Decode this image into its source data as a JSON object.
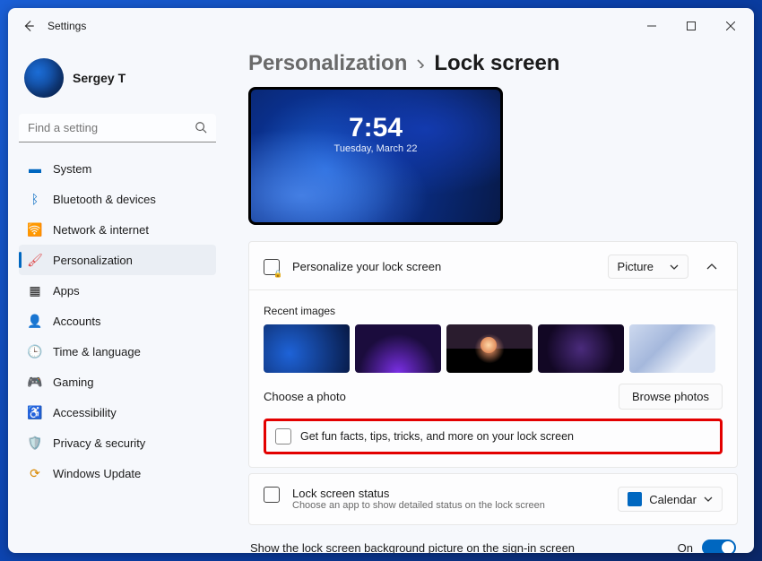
{
  "app_title": "Settings",
  "user": {
    "name": "Sergey T"
  },
  "search": {
    "placeholder": "Find a setting"
  },
  "nav": {
    "items": [
      {
        "label": "System"
      },
      {
        "label": "Bluetooth & devices"
      },
      {
        "label": "Network & internet"
      },
      {
        "label": "Personalization"
      },
      {
        "label": "Apps"
      },
      {
        "label": "Accounts"
      },
      {
        "label": "Time & language"
      },
      {
        "label": "Gaming"
      },
      {
        "label": "Accessibility"
      },
      {
        "label": "Privacy & security"
      },
      {
        "label": "Windows Update"
      }
    ]
  },
  "breadcrumb": {
    "parent": "Personalization",
    "current": "Lock screen"
  },
  "preview": {
    "time": "7:54",
    "date": "Tuesday, March 22"
  },
  "personalize": {
    "title": "Personalize your lock screen",
    "dropdown_value": "Picture",
    "recent_label": "Recent images",
    "choose_label": "Choose a photo",
    "browse_label": "Browse photos",
    "fun_facts_label": "Get fun facts, tips, tricks, and more on your lock screen"
  },
  "status": {
    "title": "Lock screen status",
    "subtitle": "Choose an app to show detailed status on the lock screen",
    "dropdown_value": "Calendar"
  },
  "signin": {
    "label": "Show the lock screen background picture on the sign-in screen",
    "value_label": "On"
  }
}
